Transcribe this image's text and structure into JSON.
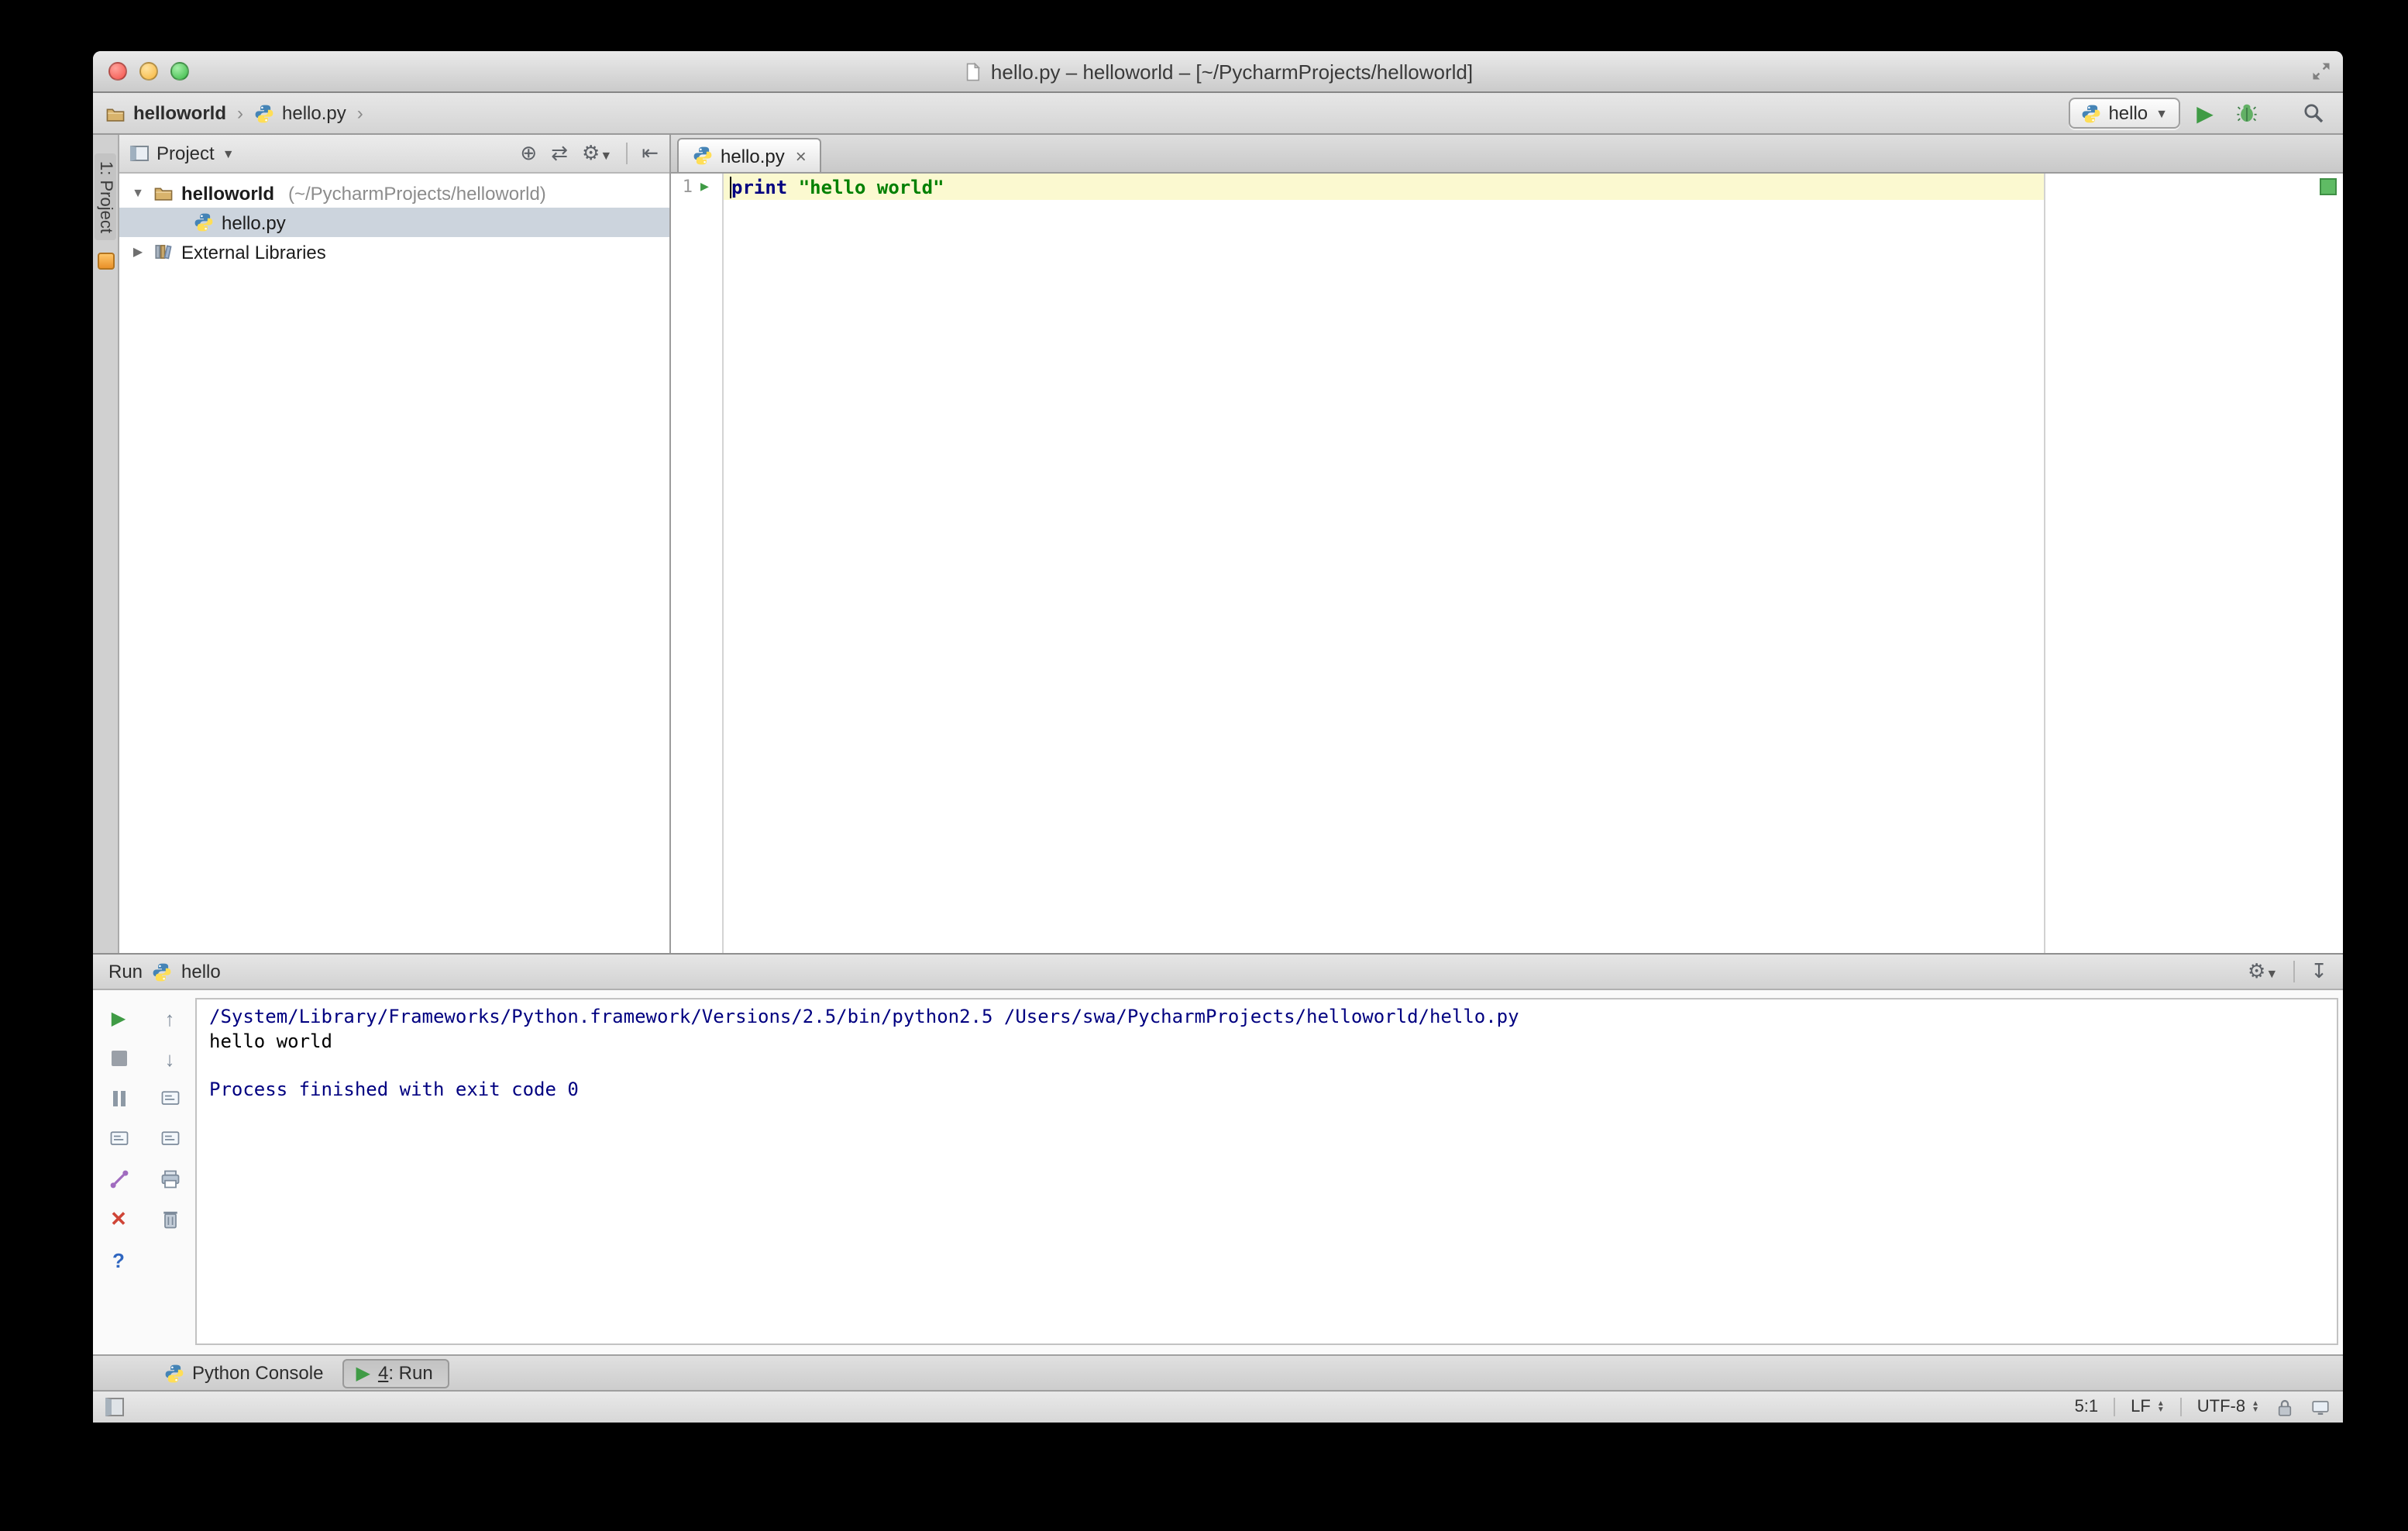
{
  "window": {
    "title": "hello.py – helloworld – [~/PycharmProjects/helloworld]"
  },
  "navbar": {
    "breadcrumb_project": "helloworld",
    "breadcrumb_file": "hello.py",
    "run_config_label": "hello"
  },
  "tool_stripe": {
    "project_button_label": "1: Project"
  },
  "project_panel": {
    "header_label": "Project",
    "tree": [
      {
        "name": "helloworld",
        "path_suffix": "(~/PycharmProjects/helloworld)"
      },
      {
        "name": "hello.py"
      },
      {
        "name": "External Libraries"
      }
    ]
  },
  "editor": {
    "tab_label": "hello.py",
    "tab_close": "×",
    "line_number": "1",
    "code_tokens": {
      "keyword": "print",
      "space": " ",
      "string": "\"hello world\""
    }
  },
  "run_panel": {
    "title_label": "Run",
    "config_label": "hello",
    "console_lines": [
      "/System/Library/Frameworks/Python.framework/Versions/2.5/bin/python2.5 /Users/swa/PycharmProjects/helloworld/hello.py",
      "hello world",
      "",
      "Process finished with exit code 0"
    ]
  },
  "bottom_bar": {
    "python_console_label": "Python Console",
    "run_tab_number": "4",
    "run_tab_rest": ": Run"
  },
  "status_bar": {
    "caret_position": "5:1",
    "line_separator": "LF",
    "encoding": "UTF-8"
  },
  "colors": {
    "keyword": "#000080",
    "string": "#008000",
    "console_system": "#000080",
    "run_green": "#3f9b45",
    "selection": "#ccd4dd",
    "current_line": "#fbf9d0"
  }
}
